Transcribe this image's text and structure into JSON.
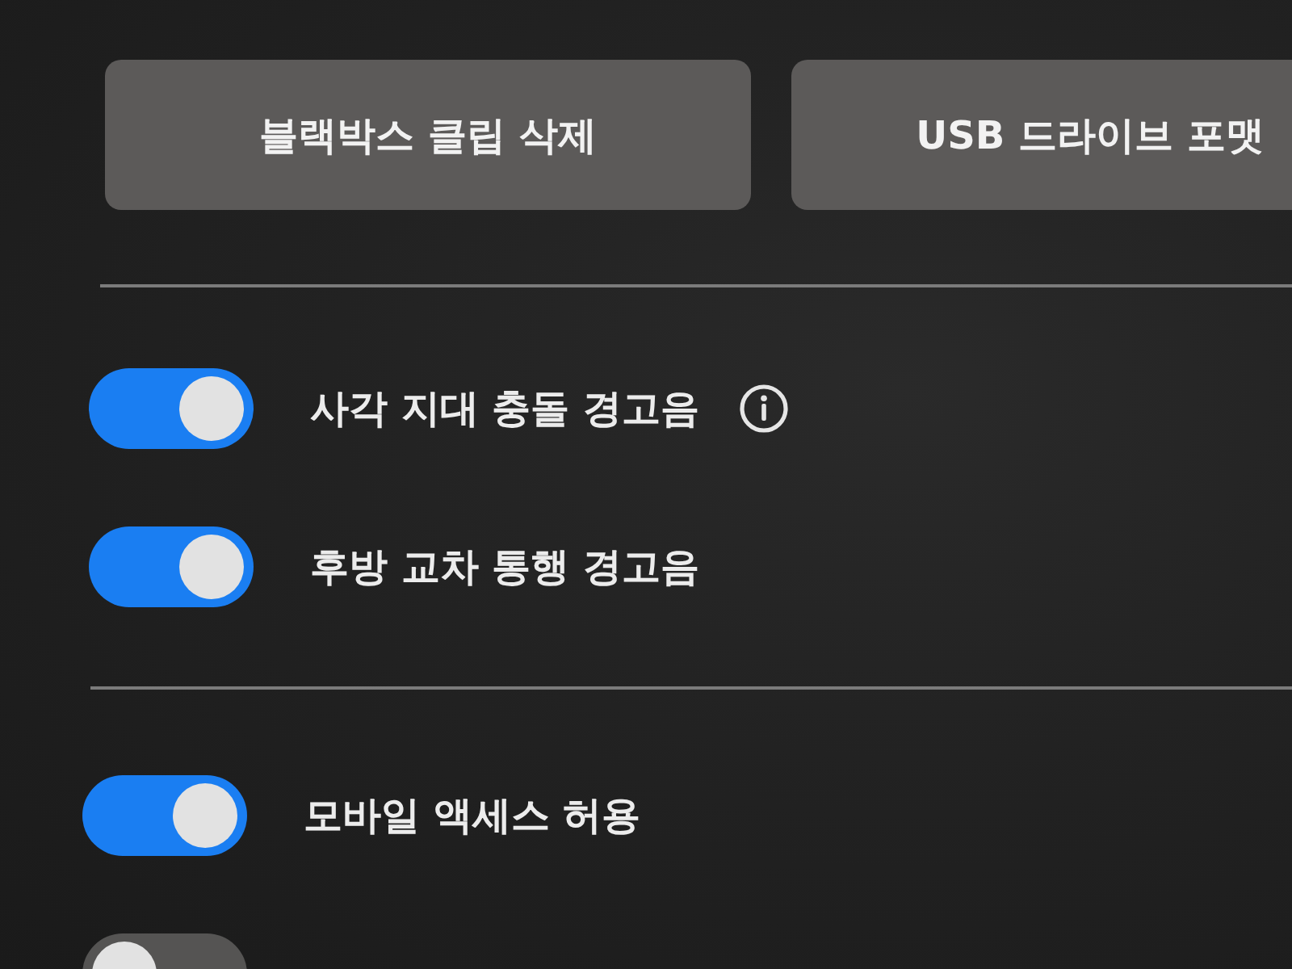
{
  "buttons": [
    {
      "label": "블랙박스 클립 삭제"
    },
    {
      "label": "USB 드라이브 포맷"
    }
  ],
  "sections": [
    {
      "toggles": [
        {
          "label": "사각 지대 충돌 경고음",
          "on": true,
          "info": true
        },
        {
          "label": "후방 교차 통행 경고음",
          "on": true,
          "info": false
        }
      ]
    },
    {
      "toggles": [
        {
          "label": "모바일 액세스 허용",
          "on": true,
          "info": false
        },
        {
          "on": false,
          "info": false
        }
      ]
    }
  ]
}
